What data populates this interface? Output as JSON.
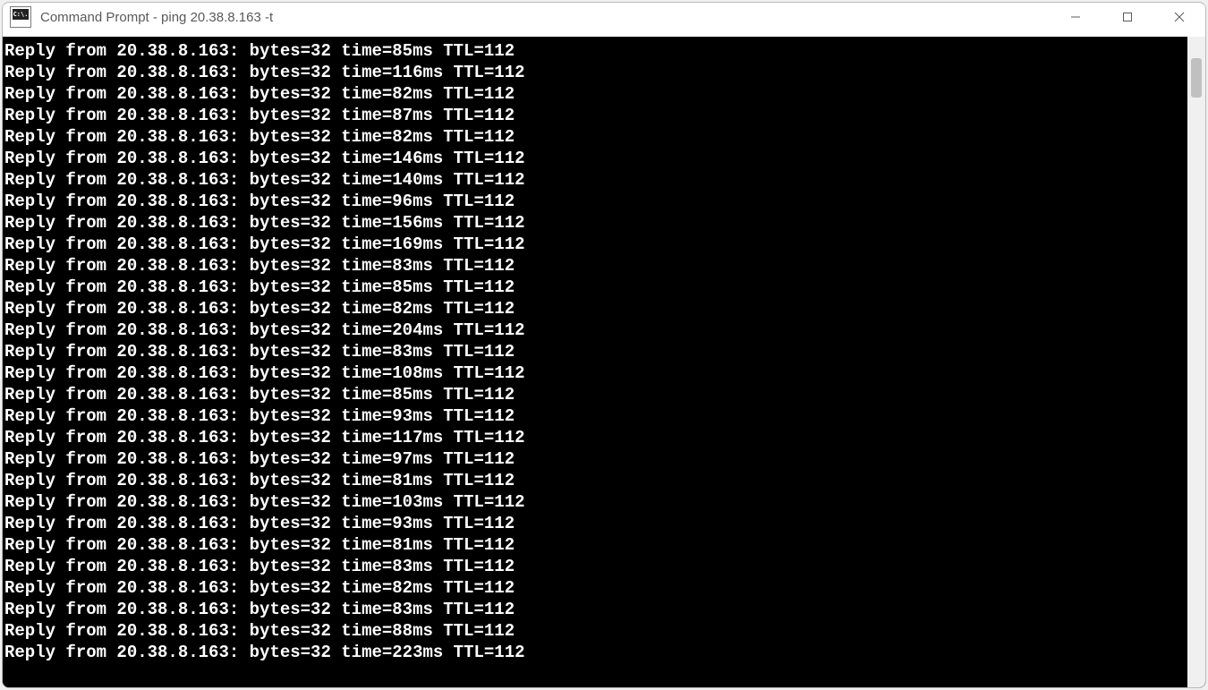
{
  "window": {
    "title": "Command Prompt - ping  20.38.8.163 -t",
    "app_icon_label": "C:\\."
  },
  "ping": {
    "ip": "20.38.8.163",
    "bytes": 32,
    "ttl": 112,
    "times_ms": [
      85,
      116,
      82,
      87,
      82,
      146,
      140,
      96,
      156,
      169,
      83,
      85,
      82,
      204,
      83,
      108,
      85,
      93,
      117,
      97,
      81,
      103,
      93,
      81,
      83,
      82,
      83,
      88,
      223
    ]
  }
}
